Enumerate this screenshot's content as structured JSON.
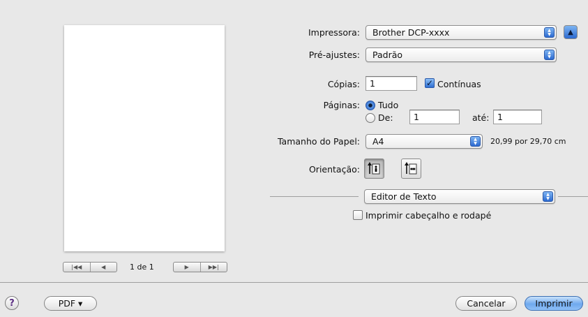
{
  "preview": {
    "page_counter": "1 de 1",
    "nav_first_icon": "first-page-icon",
    "nav_prev_icon": "previous-page-icon",
    "nav_next_icon": "next-page-icon",
    "nav_last_icon": "last-page-icon"
  },
  "printer": {
    "label": "Impressora:",
    "value": "Brother DCP-xxxx"
  },
  "presets": {
    "label": "Pré-ajustes:",
    "value": "Padrão"
  },
  "copies": {
    "label": "Cópias:",
    "value": "1",
    "collated_label": "Contínuas",
    "collated_checked": true
  },
  "pages": {
    "label": "Páginas:",
    "all_label": "Tudo",
    "all_selected": true,
    "from_label": "De:",
    "from_value": "1",
    "to_label": "até:",
    "to_value": "1"
  },
  "paper_size": {
    "label": "Tamanho do Papel:",
    "value": "A4",
    "dimensions": "20,99 por 29,70 cm"
  },
  "orientation": {
    "label": "Orientação:",
    "selected": "portrait"
  },
  "app_section": {
    "value": "Editor de Texto"
  },
  "header_footer": {
    "label": "Imprimir cabeçalho e rodapé",
    "checked": false
  },
  "footer": {
    "help_label": "?",
    "pdf_label": "PDF ▾",
    "cancel_label": "Cancelar",
    "print_label": "Imprimir"
  },
  "colors": {
    "accent": "#2c6ad0",
    "background": "#e8e8e8"
  }
}
